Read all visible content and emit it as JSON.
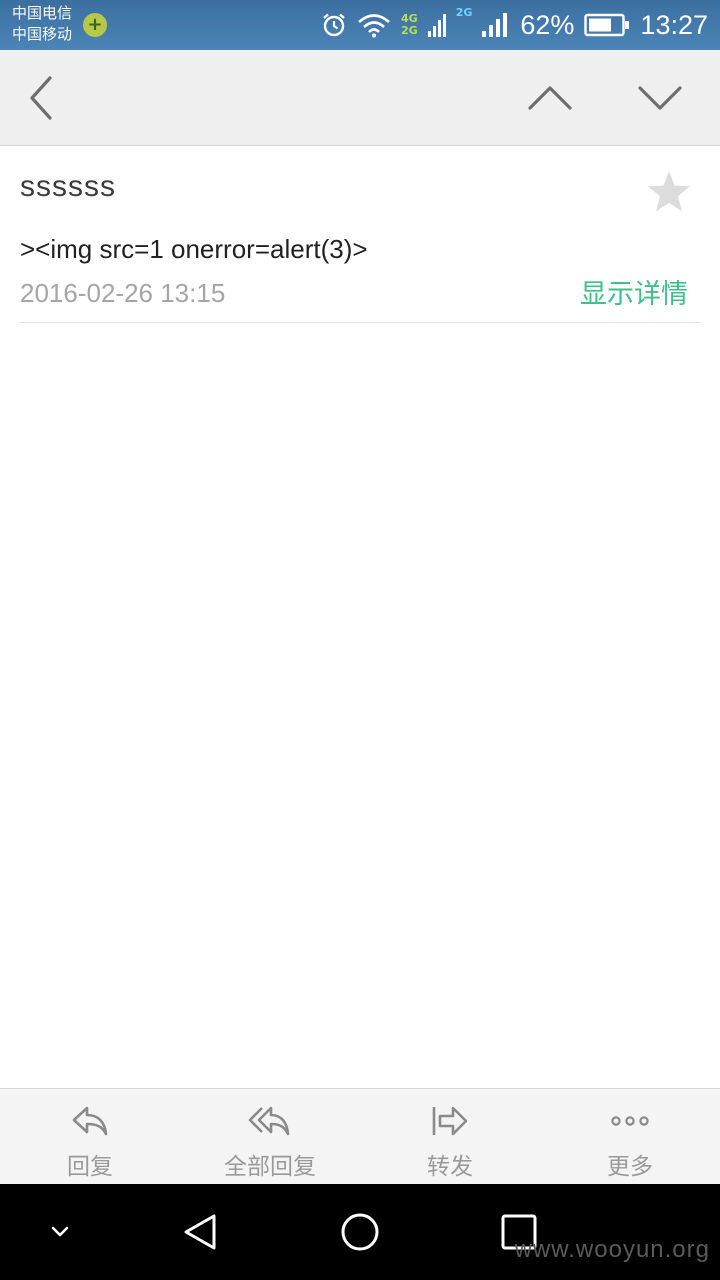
{
  "status_bar": {
    "carrier_1": "中国电信",
    "carrier_2": "中国移动",
    "net_4g": "4G",
    "net_2g_a": "2G",
    "net_2g_b": "2G",
    "battery_percent": "62%",
    "time": "13:27",
    "icons": [
      "carrier-app-icon",
      "alarm-icon",
      "wifi-icon",
      "signal-icon",
      "battery-icon"
    ]
  },
  "action_bar": {
    "icons": [
      "back-icon",
      "previous-icon",
      "next-icon"
    ]
  },
  "email": {
    "subject": "ssssss",
    "sender": "><img src=1 onerror=alert(3)>",
    "date": "2016-02-26 13:15",
    "details_link": "显示详情",
    "starred": false
  },
  "toolbar": {
    "items": [
      {
        "label": "回复",
        "icon": "reply-icon"
      },
      {
        "label": "全部回复",
        "icon": "reply-all-icon"
      },
      {
        "label": "转发",
        "icon": "forward-icon"
      },
      {
        "label": "更多",
        "icon": "more-icon"
      }
    ]
  },
  "nav_bar": {
    "icons": [
      "hide-keyboard-icon",
      "nav-back-icon",
      "home-icon",
      "recents-icon"
    ]
  },
  "watermark": "www.wooyun.org",
  "colors": {
    "status_bar": "#4b84b6",
    "accent_green": "#3fbf8a",
    "toolbar_text": "#9a9a9a"
  }
}
